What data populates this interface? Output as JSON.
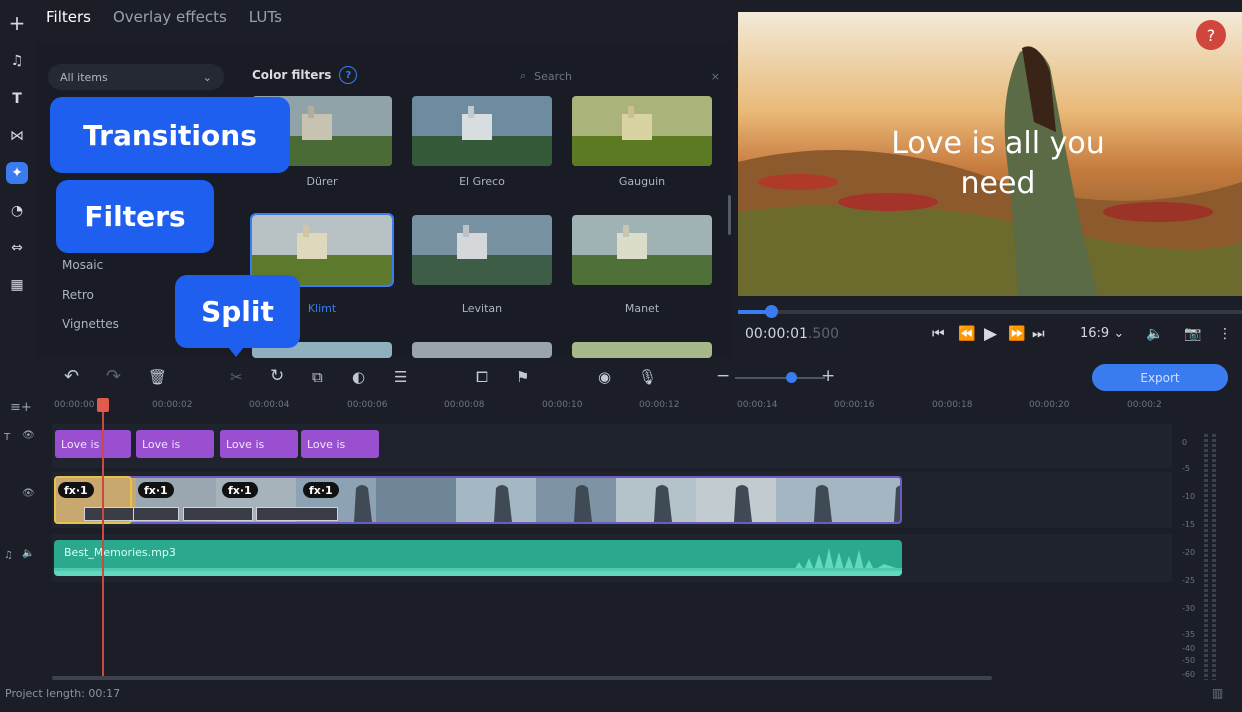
{
  "rail": {
    "add_icon": "+",
    "music_icon": "♫",
    "text_icon": "T",
    "transitions_icon": "⋈",
    "filters_icon": "✦",
    "stickers_icon": "◔",
    "callouts_icon": "⇔",
    "more_icon": "▦"
  },
  "tabs": [
    {
      "label": "Filters",
      "active": true
    },
    {
      "label": "Overlay effects",
      "active": false
    },
    {
      "label": "LUTs",
      "active": false
    }
  ],
  "dropdown": {
    "value": "All items",
    "arrow": "⌄"
  },
  "category": {
    "title": "Color filters",
    "help": "?"
  },
  "search": {
    "placeholder": "Search",
    "icon": "⌕",
    "clear": "×"
  },
  "categories": [
    "Mosaic",
    "Retro",
    "Vignettes"
  ],
  "thumbnails": [
    {
      "label": "Dürer",
      "selected": false
    },
    {
      "label": "El Greco",
      "selected": false
    },
    {
      "label": "Gauguin",
      "selected": false
    },
    {
      "label": "Klimt",
      "selected": true
    },
    {
      "label": "Levitan",
      "selected": false
    },
    {
      "label": "Manet",
      "selected": false
    }
  ],
  "callouts": {
    "transitions": "Transitions",
    "filters": "Filters",
    "split": "Split"
  },
  "preview": {
    "text_line1": "Love is all you",
    "text_line2": "need",
    "help": "?"
  },
  "player": {
    "timecode": "00:00:01",
    "timecode_frac": ".500",
    "aspect": "16:9",
    "aspect_arrow": "⌄"
  },
  "toolbar": {
    "undo": "↶",
    "redo": "↷",
    "delete": "🗑",
    "split": "✂",
    "rotate": "↻",
    "crop": "⧉",
    "color": "◐",
    "settings": "☰",
    "overlay": "⧠",
    "flag": "⚑",
    "record": "◉",
    "mic": "🎙",
    "zoom_out": "−",
    "zoom_in": "+",
    "export": "Export"
  },
  "ruler": [
    "00:00:00",
    "00:00:02",
    "00:00:04",
    "00:00:06",
    "00:00:08",
    "00:00:10",
    "00:00:12",
    "00:00:14",
    "00:00:16",
    "00:00:18",
    "00:00:20",
    "00:00:2"
  ],
  "title_clips": [
    "Love is",
    "Love is",
    "Love is",
    "Love is"
  ],
  "fx_badges": [
    "fx·1",
    "fx·1",
    "fx·1",
    "fx·1"
  ],
  "audio": {
    "filename": "Best_Memories.mp3"
  },
  "meter": [
    "0",
    "-5",
    "-10",
    "-15",
    "-20",
    "-25",
    "-30",
    "-35",
    "-40",
    "-50",
    "-60"
  ],
  "footer": {
    "project_length": "Project length: 00:17"
  },
  "colors": {
    "accent": "#3a7cf0",
    "callout": "#1f5ff0",
    "title_clip": "#9a4fd1",
    "audio_clip": "#2aa98f",
    "playhead": "#c94a42"
  }
}
